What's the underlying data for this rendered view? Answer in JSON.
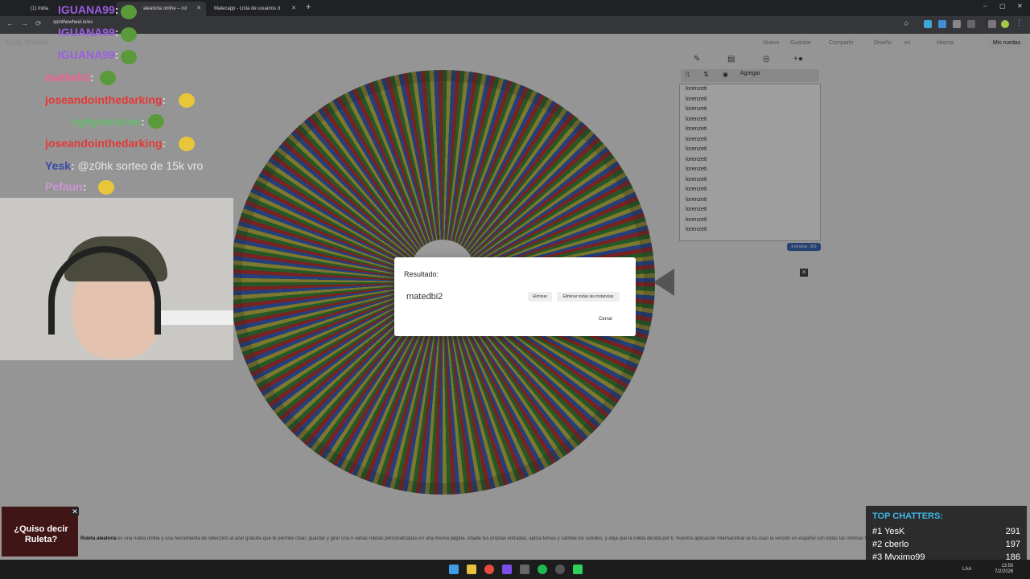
{
  "browser": {
    "tabs": [
      {
        "title": "(1) India"
      },
      {
        "title": "aleatoria online – rul"
      },
      {
        "title": "Matecapp - Lista de usuarios d"
      }
    ],
    "url": "spinthewheel.io/es"
  },
  "site": {
    "logo": "Spin Wheel",
    "nav": [
      "Nuevo",
      "Guardar",
      "Compartir",
      "Diseño",
      "es",
      "Idioma"
    ],
    "my_wheels": "Mis ruedas"
  },
  "chat": [
    {
      "user": "IGUANA99",
      "color": "#9b5de5",
      "text": ""
    },
    {
      "user": "IGUANA99",
      "color": "#9b5de5",
      "text": ""
    },
    {
      "user": "IGUANA99",
      "color": "#9b5de5",
      "text": ""
    },
    {
      "user": "matiwh3",
      "color": "#f06292",
      "text": ""
    },
    {
      "user": "joseandointhedarking",
      "color": "#e53935",
      "text": ""
    },
    {
      "user": "rigbyrackzon",
      "color": "#66bb6a",
      "text": ""
    },
    {
      "user": "joseandointhedarking",
      "color": "#e53935",
      "text": ""
    },
    {
      "user": "Yesk",
      "color": "#3949ab",
      "text": "@z0hk sorteo de 15k vro"
    },
    {
      "user": "Pefaun",
      "color": "#ce93d8",
      "text": ""
    }
  ],
  "panel": {
    "add_label": "Agregar",
    "entries": [
      "lorenzeti",
      "lorenzeti",
      "lorenzeti",
      "lorenzeti",
      "lorenzeti",
      "lorenzeti",
      "lorenzeti",
      "lorenzeti",
      "lorenzeti",
      "lorenzeti",
      "lorenzeti",
      "lorenzeti",
      "lorenzeti",
      "lorenzeti",
      "lorenzeti"
    ],
    "entries_count": "Entradas: 363"
  },
  "modal": {
    "title": "Resultado:",
    "result": "matedbi2",
    "remove": "Eliminar",
    "remove_all": "Eliminar todas las instancias",
    "close": "Cerrar"
  },
  "description": {
    "bold": "Ruleta aleatoria",
    "text": " es una ruleta online y una herramienta de selección al azar gratuita que te permite crear, guardar y girar una o varias ruletas personalizadas en una misma página. Añade tus propias entradas, aplica temas y cambia los sonidos, y deja que la ruleta decida por ti. Nuestra aplicación internacional se lla usas la versión en español con todas las mismas funciones."
  },
  "promo": {
    "text": "¿Quiso decir Ruleta?"
  },
  "top_chatters": {
    "title": "TOP CHATTERS:",
    "rows": [
      {
        "rank": "#1",
        "name": "YesK",
        "count": "291"
      },
      {
        "rank": "#2",
        "name": "cberlo",
        "count": "197"
      },
      {
        "rank": "#3",
        "name": "Mvximo99",
        "count": "186"
      }
    ]
  },
  "taskbar": {
    "lang": "LAA",
    "time": "13:50",
    "date": "7/2/2026"
  }
}
